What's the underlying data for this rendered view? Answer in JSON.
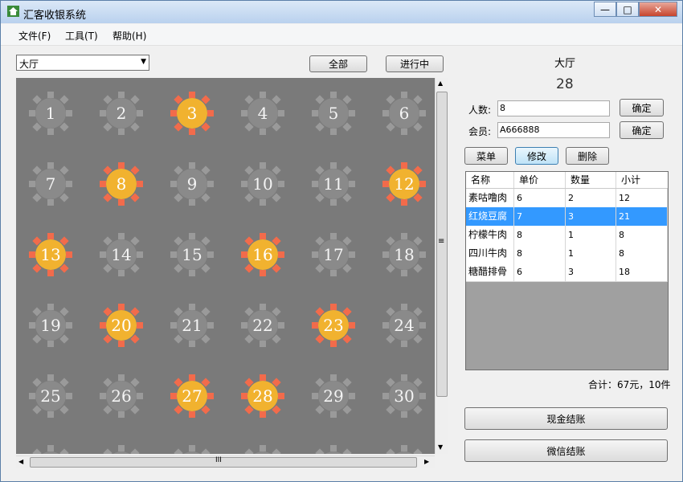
{
  "window": {
    "title": "汇客收银系统",
    "minimize": "—",
    "maximize": "□",
    "close": "✕"
  },
  "menu": [
    "文件(F)",
    "工具(T)",
    "帮助(H)"
  ],
  "area_select": {
    "value": "大厅",
    "arrow": "▼"
  },
  "filters": {
    "all": "全部",
    "in_progress": "进行中"
  },
  "tables": [
    {
      "number": "1",
      "occupied": false
    },
    {
      "number": "2",
      "occupied": false
    },
    {
      "number": "3",
      "occupied": true
    },
    {
      "number": "4",
      "occupied": false
    },
    {
      "number": "5",
      "occupied": false
    },
    {
      "number": "6",
      "occupied": false
    },
    {
      "number": "7",
      "occupied": false
    },
    {
      "number": "8",
      "occupied": true
    },
    {
      "number": "9",
      "occupied": false
    },
    {
      "number": "10",
      "occupied": false
    },
    {
      "number": "11",
      "occupied": false
    },
    {
      "number": "12",
      "occupied": true
    },
    {
      "number": "13",
      "occupied": true
    },
    {
      "number": "14",
      "occupied": false
    },
    {
      "number": "15",
      "occupied": false
    },
    {
      "number": "16",
      "occupied": true
    },
    {
      "number": "17",
      "occupied": false
    },
    {
      "number": "18",
      "occupied": false
    },
    {
      "number": "19",
      "occupied": false
    },
    {
      "number": "20",
      "occupied": true
    },
    {
      "number": "21",
      "occupied": false
    },
    {
      "number": "22",
      "occupied": false
    },
    {
      "number": "23",
      "occupied": true
    },
    {
      "number": "24",
      "occupied": false
    },
    {
      "number": "25",
      "occupied": false
    },
    {
      "number": "26",
      "occupied": false
    },
    {
      "number": "27",
      "occupied": true
    },
    {
      "number": "28",
      "occupied": true
    },
    {
      "number": "29",
      "occupied": false
    },
    {
      "number": "30",
      "occupied": false
    }
  ],
  "scroll": {
    "up": "▲",
    "down": "▼",
    "left": "◀",
    "right": "▶",
    "v_grip": "≡",
    "h_grip": "III"
  },
  "detail": {
    "area": "大厅",
    "table_no": "28",
    "people_label": "人数:",
    "people_value": "8",
    "member_label": "会员:",
    "member_value": "A666888",
    "confirm": "确定"
  },
  "actions": {
    "menu": "菜单",
    "edit": "修改",
    "delete": "删除"
  },
  "order": {
    "headers": [
      "名称",
      "单价",
      "数量",
      "小计"
    ],
    "rows": [
      [
        "素咕噜肉",
        "6",
        "2",
        "12"
      ],
      [
        "红烧豆腐",
        "7",
        "3",
        "21"
      ],
      [
        "柠檬牛肉",
        "8",
        "1",
        "8"
      ],
      [
        "四川牛肉",
        "8",
        "1",
        "8"
      ],
      [
        "糖醋排骨",
        "6",
        "3",
        "18"
      ]
    ],
    "selected_row": 1
  },
  "total": "合计：67元，10件",
  "pay": {
    "cash": "现金结账",
    "wechat": "微信结账"
  }
}
